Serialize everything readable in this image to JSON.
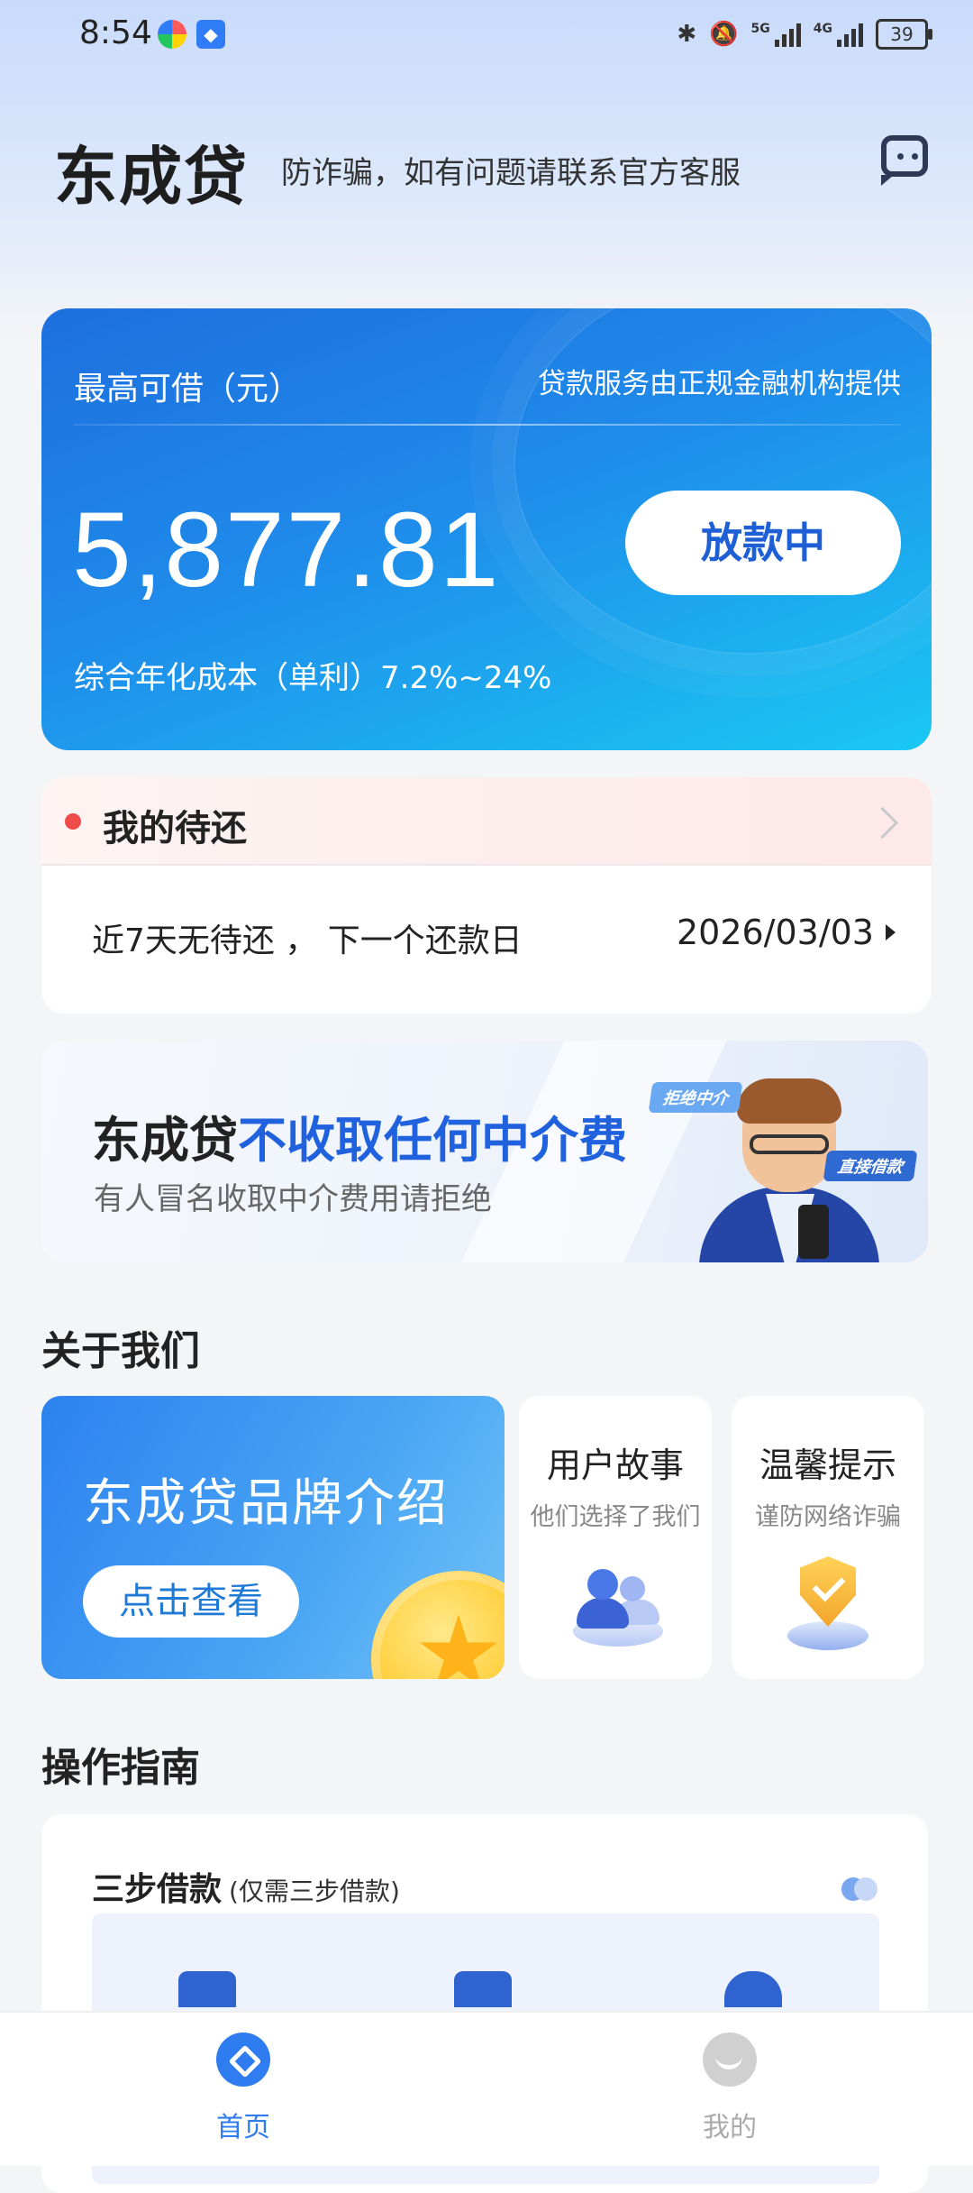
{
  "status_bar": {
    "time": "8:54",
    "network1": "5G",
    "network2": "4G",
    "battery": "39"
  },
  "header": {
    "title": "东成贷",
    "subtitle": "防诈骗，如有问题请联系官方客服",
    "service_icon": "chat-icon"
  },
  "loan_card": {
    "label": "最高可借（元）",
    "provider_note": "贷款服务由正规金融机构提供",
    "amount": "5,877.81",
    "button_label": "放款中",
    "rate_text": "综合年化成本（单利）7.2%~24%",
    "gradient_start": "#1d6fde",
    "gradient_end": "#1ac8f3"
  },
  "repayment": {
    "title": "我的待还",
    "info": "近7天无待还 ， 下一个还款日",
    "date": "2026/03/03"
  },
  "banner": {
    "title_prefix": "东成贷",
    "title_highlight": "不收取任何中介费",
    "subtitle": "有人冒名收取中介费用请拒绝",
    "tag1": "拒绝中介",
    "tag2": "直接借款"
  },
  "about": {
    "section_title": "关于我们",
    "brand": {
      "title": "东成贷品牌介绍",
      "button": "点击查看"
    },
    "cards": [
      {
        "title": "用户故事",
        "subtitle": "他们选择了我们"
      },
      {
        "title": "温馨提示",
        "subtitle": "谨防网络诈骗"
      }
    ]
  },
  "guide": {
    "section_title": "操作指南",
    "card_title": "三步借款",
    "card_note": "(仅需三步借款)"
  },
  "bottom_nav": {
    "items": [
      {
        "label": "首页",
        "active": true
      },
      {
        "label": "我的",
        "active": false
      }
    ]
  },
  "colors": {
    "accent": "#2f7bf0",
    "highlight": "#2062de",
    "alert": "#f04b4b"
  }
}
